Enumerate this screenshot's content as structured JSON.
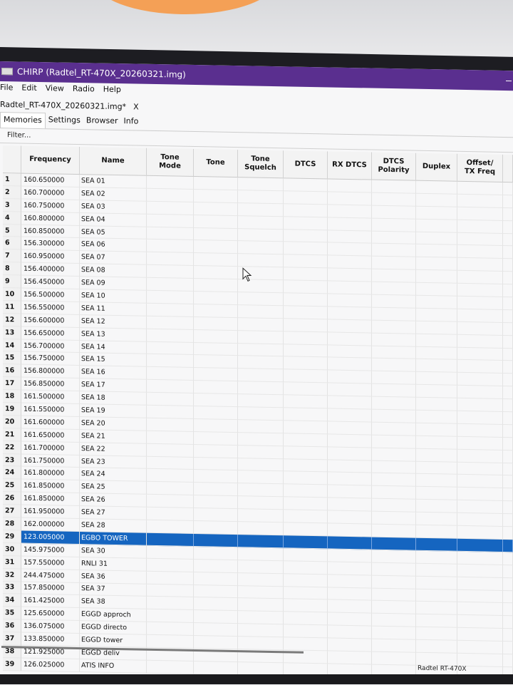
{
  "window": {
    "title": "CHIRP (Radtel_RT-470X_20260321.img)"
  },
  "menu": [
    "File",
    "Edit",
    "View",
    "Radio",
    "Help"
  ],
  "doc_tab": {
    "label": "Radtel_RT-470X_20260321.img*",
    "close": "X"
  },
  "tabs": [
    {
      "label": "Memories",
      "active": true
    },
    {
      "label": "Settings",
      "active": false
    },
    {
      "label": "Browser",
      "active": false
    },
    {
      "label": "Info",
      "active": false
    }
  ],
  "filter_placeholder": "Filter...",
  "columns": [
    "Frequency",
    "Name",
    "Tone\nMode",
    "Tone",
    "Tone\nSquelch",
    "DTCS",
    "RX DTCS",
    "DTCS\nPolarity",
    "Duplex",
    "Offset/\nTX Freq"
  ],
  "rows": [
    [
      "1",
      "160.650000",
      "SEA 01"
    ],
    [
      "2",
      "160.700000",
      "SEA 02"
    ],
    [
      "3",
      "160.750000",
      "SEA 03"
    ],
    [
      "4",
      "160.800000",
      "SEA 04"
    ],
    [
      "5",
      "160.850000",
      "SEA 05"
    ],
    [
      "6",
      "156.300000",
      "SEA 06"
    ],
    [
      "7",
      "160.950000",
      "SEA 07"
    ],
    [
      "8",
      "156.400000",
      "SEA 08"
    ],
    [
      "9",
      "156.450000",
      "SEA 09"
    ],
    [
      "10",
      "156.500000",
      "SEA 10"
    ],
    [
      "11",
      "156.550000",
      "SEA 11"
    ],
    [
      "12",
      "156.600000",
      "SEA 12"
    ],
    [
      "13",
      "156.650000",
      "SEA 13"
    ],
    [
      "14",
      "156.700000",
      "SEA 14"
    ],
    [
      "15",
      "156.750000",
      "SEA 15"
    ],
    [
      "16",
      "156.800000",
      "SEA 16"
    ],
    [
      "17",
      "156.850000",
      "SEA 17"
    ],
    [
      "18",
      "161.500000",
      "SEA 18"
    ],
    [
      "19",
      "161.550000",
      "SEA 19"
    ],
    [
      "20",
      "161.600000",
      "SEA 20"
    ],
    [
      "21",
      "161.650000",
      "SEA 21"
    ],
    [
      "22",
      "161.700000",
      "SEA 22"
    ],
    [
      "23",
      "161.750000",
      "SEA 23"
    ],
    [
      "24",
      "161.800000",
      "SEA 24"
    ],
    [
      "25",
      "161.850000",
      "SEA 25"
    ],
    [
      "26",
      "161.850000",
      "SEA 26"
    ],
    [
      "27",
      "161.950000",
      "SEA 27"
    ],
    [
      "28",
      "162.000000",
      "SEA 28"
    ],
    [
      "29",
      "123.005000",
      "EGBO TOWER"
    ],
    [
      "30",
      "145.975000",
      "SEA 30"
    ],
    [
      "31",
      "157.550000",
      "RNLI 31"
    ],
    [
      "32",
      "244.475000",
      "SEA 36"
    ],
    [
      "33",
      "157.850000",
      "SEA 37"
    ],
    [
      "34",
      "161.425000",
      "SEA 38"
    ],
    [
      "35",
      "125.650000",
      "EGGD approch"
    ],
    [
      "36",
      "136.075000",
      "EGGD directo"
    ],
    [
      "37",
      "133.850000",
      "EGGD tower"
    ],
    [
      "38",
      "121.925000",
      "EGGD deliv"
    ],
    [
      "39",
      "126.025000",
      "ATIS INFO"
    ]
  ],
  "selected_row": "29",
  "status_text": "Radtel RT-470X",
  "colors": {
    "titlebar": "#5a2f8f",
    "selection": "#1565c0"
  }
}
